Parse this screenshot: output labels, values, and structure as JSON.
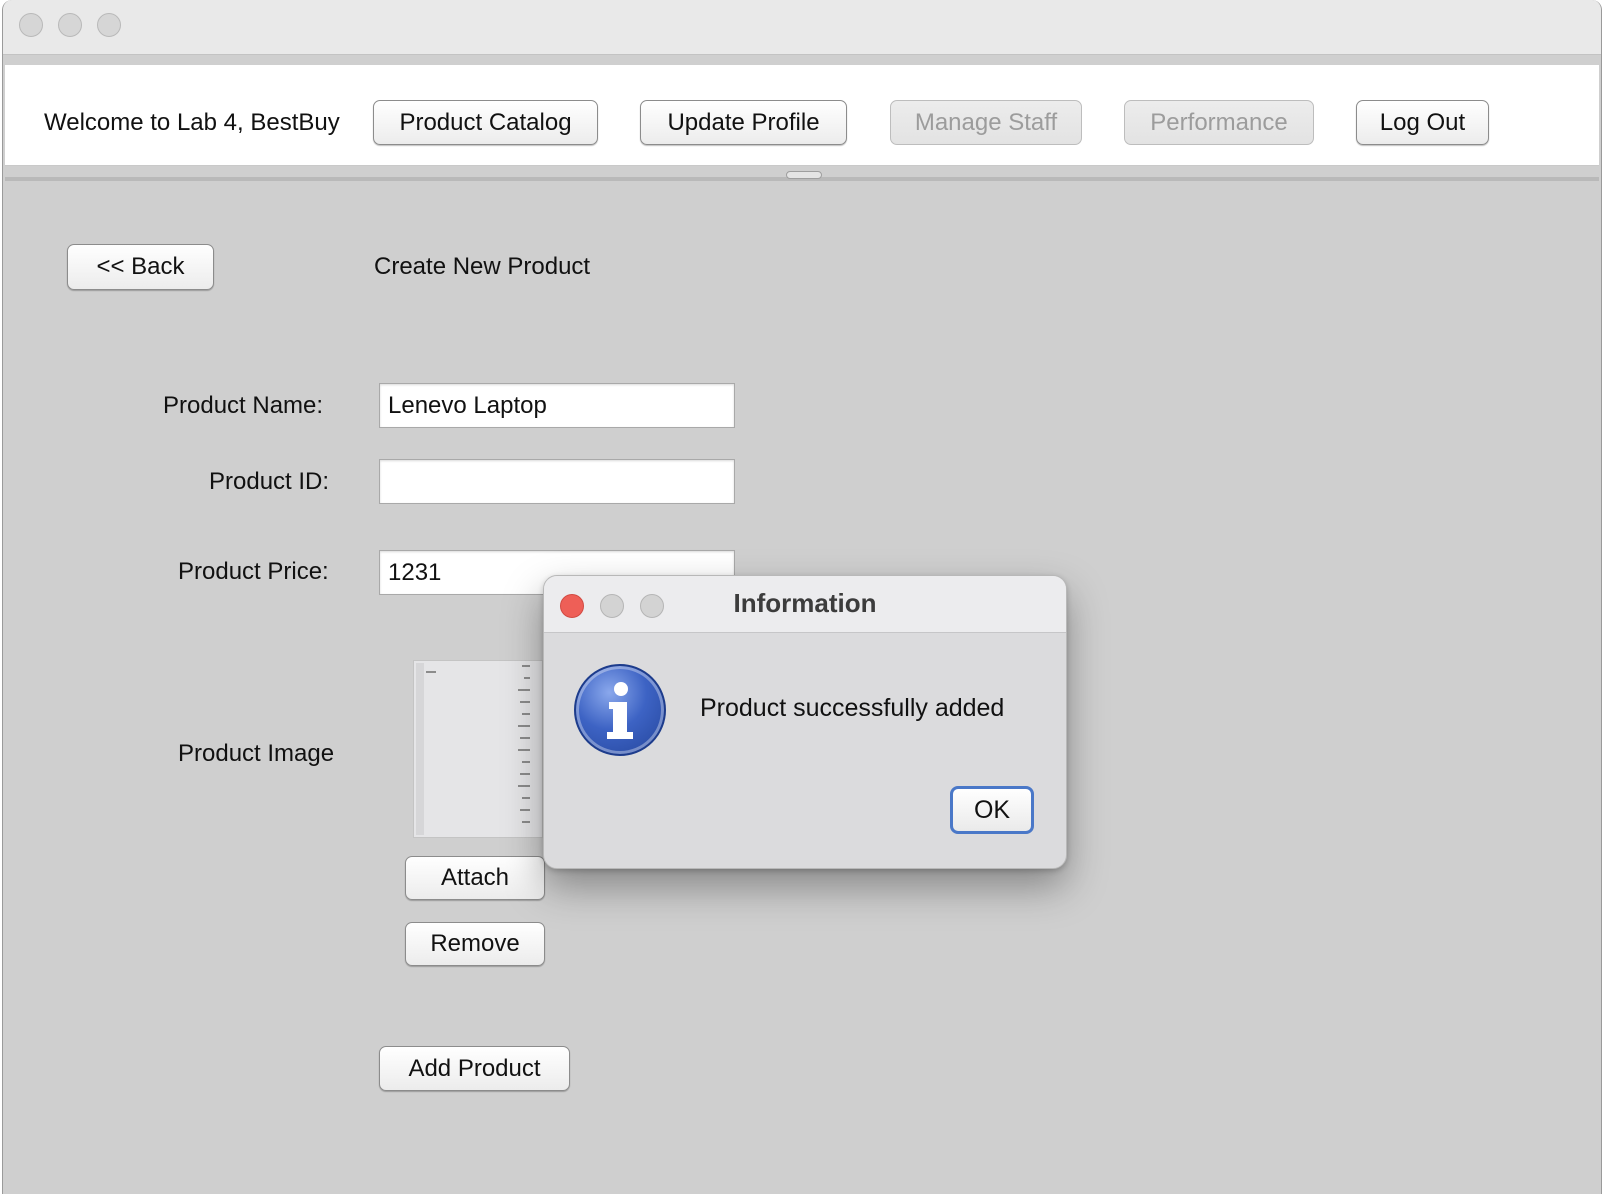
{
  "header": {
    "welcome": "Welcome to Lab 4, BestBuy",
    "buttons": {
      "product_catalog": "Product Catalog",
      "update_profile": "Update Profile",
      "manage_staff": "Manage Staff",
      "performance": "Performance",
      "log_out": "Log Out"
    }
  },
  "form": {
    "back": "<< Back",
    "title": "Create New Product",
    "name_label": "Product Name:",
    "name_value": "Lenevo Laptop",
    "id_label": "Product ID:",
    "id_value": "",
    "price_label": "Product Price:",
    "price_value": "1231",
    "image_label": "Product Image",
    "attach": "Attach",
    "remove": "Remove",
    "add_product": "Add Product"
  },
  "dialog": {
    "title": "Information",
    "message": "Product successfully added",
    "ok": "OK",
    "icon": "info-icon"
  },
  "colors": {
    "close_red": "#ee5f57",
    "info_blue": "#3d63c4",
    "focus_ring": "#4a78c8"
  }
}
